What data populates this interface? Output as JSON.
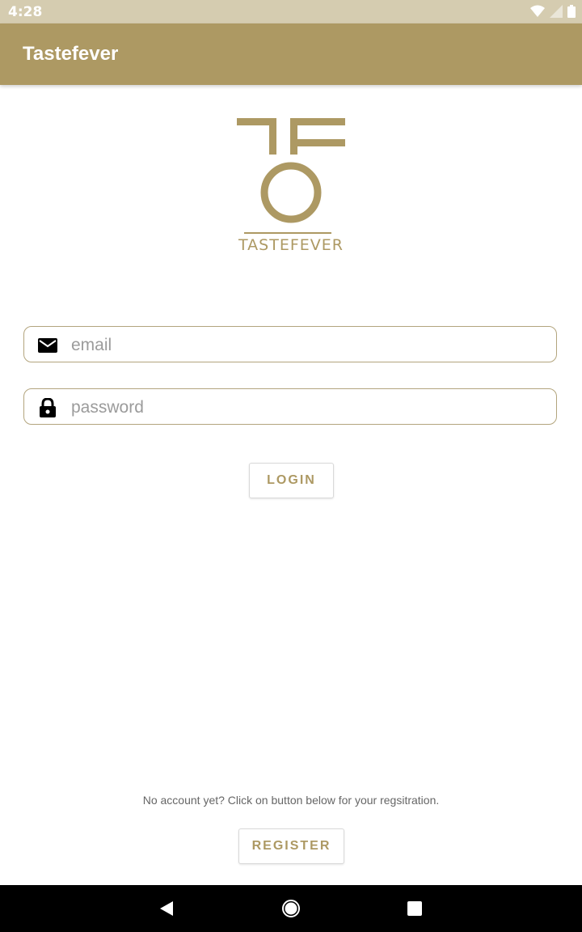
{
  "status_bar": {
    "time": "4:28",
    "icons": [
      "wifi-icon",
      "signal-icon",
      "battery-icon"
    ]
  },
  "app_bar": {
    "title": "Tastefever",
    "background": "#ad9963"
  },
  "logo": {
    "caption": "TASTEFEVER",
    "color": "#ad9963"
  },
  "form": {
    "email": {
      "value": "",
      "placeholder": "email",
      "icon": "mail-icon"
    },
    "password": {
      "value": "",
      "placeholder": "password",
      "icon": "lock-icon"
    },
    "login_label": "LOGIN"
  },
  "register": {
    "hint": "No account yet? Click on button below for your regsitration.",
    "button_label": "REGISTER"
  },
  "nav_bar": {
    "icons": [
      "back-icon",
      "home-icon",
      "recents-icon"
    ]
  },
  "colors": {
    "accent": "#ad9963",
    "status_bar": "#d5ccb0",
    "nav_bar": "#000000"
  }
}
